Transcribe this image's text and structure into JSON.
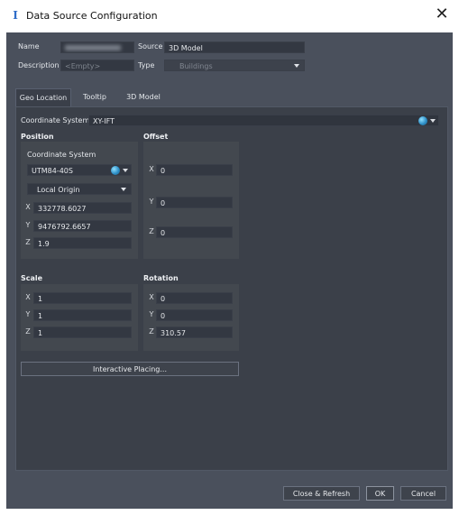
{
  "window": {
    "title": "Data Source Configuration",
    "close_glyph": "✕",
    "app_icon": "I"
  },
  "header": {
    "name_label": "Name",
    "name_value": "",
    "source_label": "Source",
    "source_value": "3D Model",
    "description_label": "Description",
    "description_placeholder": "<Empty>",
    "type_label": "Type",
    "type_value": "Buildings"
  },
  "tabs": [
    {
      "label": "Geo Location",
      "active": true
    },
    {
      "label": "Tooltip",
      "active": false
    },
    {
      "label": "3D Model",
      "active": false
    }
  ],
  "coordinate_system": {
    "label": "Coordinate System",
    "value": "XY-IFT"
  },
  "position": {
    "title": "Position",
    "cs_label": "Coordinate System",
    "cs_value": "UTM84-40S",
    "origin_value": "Local Origin",
    "x": "332778.6027",
    "y": "9476792.6657",
    "z": "1.9"
  },
  "offset": {
    "title": "Offset",
    "x": "0",
    "y": "0",
    "z": "0"
  },
  "scale": {
    "title": "Scale",
    "x": "1",
    "y": "1",
    "z": "1"
  },
  "rotation": {
    "title": "Rotation",
    "x": "0",
    "y": "0",
    "z": "310.57"
  },
  "axes": {
    "x": "X",
    "y": "Y",
    "z": "Z"
  },
  "interactive_placing_label": "Interactive Placing...",
  "footer": {
    "close_refresh": "Close & Refresh",
    "ok": "OK",
    "cancel": "Cancel"
  },
  "colors": {
    "background": "#4a505c",
    "panel": "#3b4049",
    "field": "#333842",
    "accent_globe": "#2e8fc7"
  }
}
